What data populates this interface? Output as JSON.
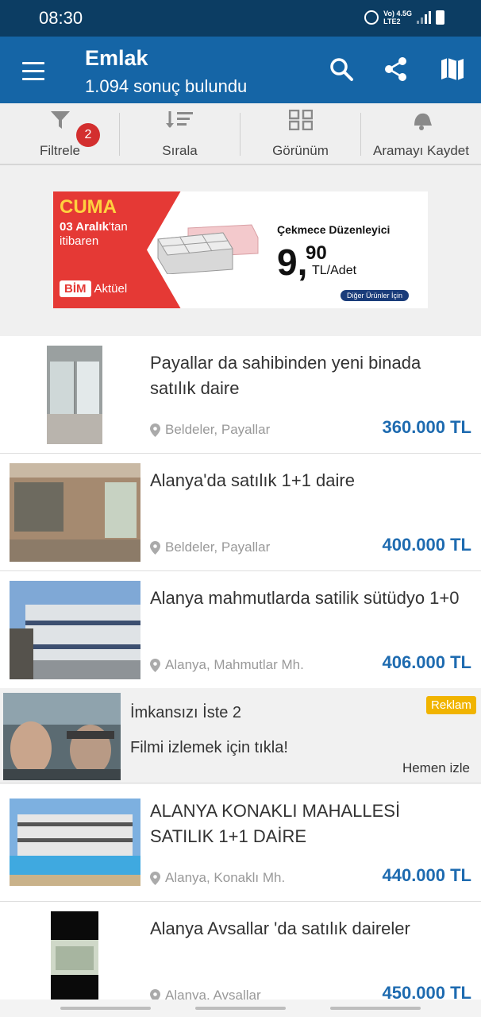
{
  "status": {
    "time": "08:30",
    "net_top": "Vo) 4.5G",
    "net_bottom": "LTE2"
  },
  "app_bar": {
    "title": "Emlak",
    "subtitle": "1.094 sonuç bulundu"
  },
  "toolbar": {
    "filter_label": "Filtrele",
    "filter_count": "2",
    "sort_label": "Sırala",
    "view_label": "Görünüm",
    "save_search_label": "Aramayı Kaydet"
  },
  "banner": {
    "day": "CUMA",
    "date_bold": "03 Aralık",
    "date_rest": "'tan",
    "date_line2": "itibaren",
    "brand": "BİM",
    "brand_suffix": "Aktüel",
    "product": "Çekmece Düzenleyici",
    "price_int": "9,",
    "price_dec": "90",
    "price_unit": "TL/Adet",
    "more": "Diğer Ürünler İçin",
    "colors": {
      "red": "#e53935",
      "yellow": "#ffd23f",
      "navy": "#1a3c7a"
    }
  },
  "listings": [
    {
      "title": "Payallar da sahibinden yeni binada satılık daire",
      "location": "Beldeler, Payallar",
      "price": "360.000 TL"
    },
    {
      "title": "Alanya'da satılık 1+1 daire",
      "location": "Beldeler, Payallar",
      "price": "400.000 TL"
    },
    {
      "title": "Alanya mahmutlarda satilik sütüdyo 1+0",
      "location": "Alanya, Mahmutlar Mh.",
      "price": "406.000 TL"
    },
    {
      "title": "ALANYA KONAKLI MAHALLESİ SATILIK 1+1 DAİRE",
      "location": "Alanya, Konaklı Mh.",
      "price": "440.000 TL"
    },
    {
      "title": "Alanya Avsallar 'da satılık daireler",
      "location": "Alanya, Avsallar",
      "price": "450.000 TL"
    }
  ],
  "ad": {
    "title": "İmkansızı İste 2",
    "subtitle": "Filmi izlemek için tıkla!",
    "badge": "Reklam",
    "cta": "Hemen izle"
  },
  "colors": {
    "status_bar": "#0c3d63",
    "app_bar": "#1565a6",
    "price": "#1e6bb0",
    "badge": "#d32f2f",
    "ad_badge": "#f1b400"
  }
}
